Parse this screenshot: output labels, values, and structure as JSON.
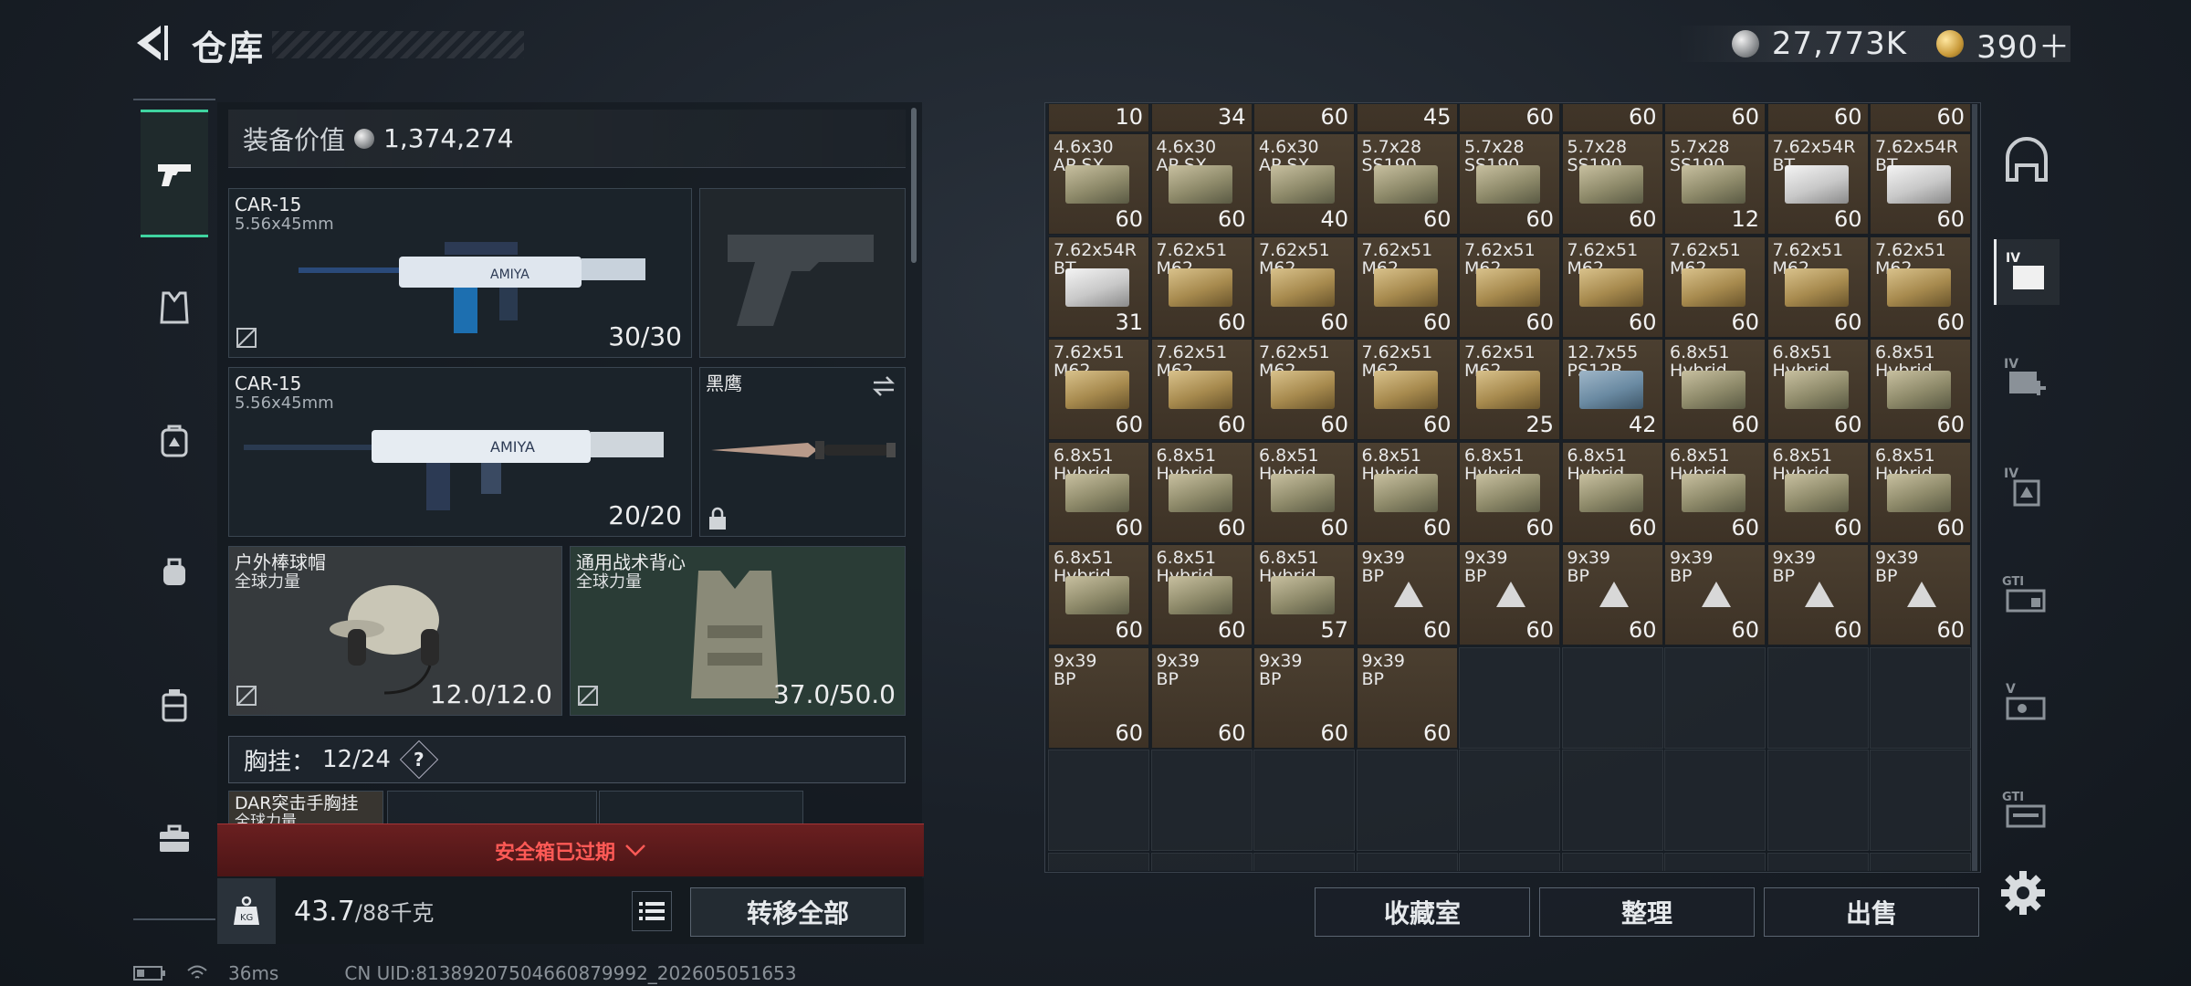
{
  "header": {
    "title": "仓库"
  },
  "currency": {
    "silver": "27,773K",
    "gold": "390＋"
  },
  "equipment": {
    "value_label": "装备价值",
    "value": "1,374,274",
    "primary_weapon": {
      "name": "CAR-15",
      "caliber": "5.56x45mm",
      "ammo": "30/30"
    },
    "secondary_weapon": {
      "name": "CAR-15",
      "caliber": "5.56x45mm",
      "ammo": "20/20"
    },
    "melee": {
      "name": "黑鹰"
    },
    "helmet": {
      "name": "户外棒球帽",
      "sub": "全球力量",
      "durability": "12.0/12.0"
    },
    "armor": {
      "name": "通用战术背心",
      "sub": "全球力量",
      "durability": "37.0/50.0"
    },
    "chest_rig": {
      "label": "胸挂：",
      "value": "12/24",
      "help": "?"
    },
    "rig_item": {
      "name": "DAR突击手胸挂",
      "sub": "全球力量"
    },
    "safebox_status": "安全箱已过期",
    "weight": {
      "value": "43.7",
      "capacity": "/88千克"
    },
    "transfer_all": "转移全部"
  },
  "status_bar": {
    "ping": "36ms",
    "uid": "CN UID:81389207504660879992_202605051653"
  },
  "inventory": {
    "top_row_qty": [
      "10",
      "34",
      "60",
      "45",
      "60",
      "60",
      "60",
      "60",
      "60"
    ],
    "rows": [
      [
        {
          "cal": "4.6x30\nAP SX",
          "qty": "60",
          "box": "olive"
        },
        {
          "cal": "4.6x30\nAP SX",
          "qty": "60",
          "box": "olive"
        },
        {
          "cal": "4.6x30\nAP SX",
          "qty": "40",
          "box": "olive"
        },
        {
          "cal": "5.7x28\nSS190",
          "qty": "60",
          "box": "olive"
        },
        {
          "cal": "5.7x28\nSS190",
          "qty": "60",
          "box": "olive"
        },
        {
          "cal": "5.7x28\nSS190",
          "qty": "60",
          "box": "olive"
        },
        {
          "cal": "5.7x28\nSS190",
          "qty": "12",
          "box": "olive"
        },
        {
          "cal": "7.62x54R\nBT",
          "qty": "60",
          "box": "white"
        },
        {
          "cal": "7.62x54R\nBT",
          "qty": "60",
          "box": "white"
        }
      ],
      [
        {
          "cal": "7.62x54R\nBT",
          "qty": "31",
          "box": "white"
        },
        {
          "cal": "7.62x51\nM62",
          "qty": "60",
          "box": "tan"
        },
        {
          "cal": "7.62x51\nM62",
          "qty": "60",
          "box": "tan"
        },
        {
          "cal": "7.62x51\nM62",
          "qty": "60",
          "box": "tan"
        },
        {
          "cal": "7.62x51\nM62",
          "qty": "60",
          "box": "tan"
        },
        {
          "cal": "7.62x51\nM62",
          "qty": "60",
          "box": "tan"
        },
        {
          "cal": "7.62x51\nM62",
          "qty": "60",
          "box": "tan"
        },
        {
          "cal": "7.62x51\nM62",
          "qty": "60",
          "box": "tan"
        },
        {
          "cal": "7.62x51\nM62",
          "qty": "60",
          "box": "tan"
        }
      ],
      [
        {
          "cal": "7.62x51\nM62",
          "qty": "60",
          "box": "tan"
        },
        {
          "cal": "7.62x51\nM62",
          "qty": "60",
          "box": "tan"
        },
        {
          "cal": "7.62x51\nM62",
          "qty": "60",
          "box": "tan"
        },
        {
          "cal": "7.62x51\nM62",
          "qty": "60",
          "box": "tan"
        },
        {
          "cal": "7.62x51\nM62",
          "qty": "25",
          "box": "tan"
        },
        {
          "cal": "12.7x55\nPS12B",
          "qty": "42",
          "box": "blue"
        },
        {
          "cal": "6.8x51\nHybrid",
          "qty": "60",
          "box": "olive"
        },
        {
          "cal": "6.8x51\nHybrid",
          "qty": "60",
          "box": "olive"
        },
        {
          "cal": "6.8x51\nHybrid",
          "qty": "60",
          "box": "olive"
        }
      ],
      [
        {
          "cal": "6.8x51\nHybrid",
          "qty": "60",
          "box": "olive"
        },
        {
          "cal": "6.8x51\nHybrid",
          "qty": "60",
          "box": "olive"
        },
        {
          "cal": "6.8x51\nHybrid",
          "qty": "60",
          "box": "olive"
        },
        {
          "cal": "6.8x51\nHybrid",
          "qty": "60",
          "box": "olive"
        },
        {
          "cal": "6.8x51\nHybrid",
          "qty": "60",
          "box": "olive"
        },
        {
          "cal": "6.8x51\nHybrid",
          "qty": "60",
          "box": "olive"
        },
        {
          "cal": "6.8x51\nHybrid",
          "qty": "60",
          "box": "olive"
        },
        {
          "cal": "6.8x51\nHybrid",
          "qty": "60",
          "box": "olive"
        },
        {
          "cal": "6.8x51\nHybrid",
          "qty": "60",
          "box": "olive"
        }
      ],
      [
        {
          "cal": "6.8x51\nHybrid",
          "qty": "60",
          "box": "olive"
        },
        {
          "cal": "6.8x51\nHybrid",
          "qty": "60",
          "box": "olive"
        },
        {
          "cal": "6.8x51\nHybrid",
          "qty": "57",
          "box": "olive"
        },
        {
          "cal": "9x39\nBP",
          "qty": "60",
          "box": "tri"
        },
        {
          "cal": "9x39\nBP",
          "qty": "60",
          "box": "tri"
        },
        {
          "cal": "9x39\nBP",
          "qty": "60",
          "box": "tri"
        },
        {
          "cal": "9x39\nBP",
          "qty": "60",
          "box": "tri"
        },
        {
          "cal": "9x39\nBP",
          "qty": "60",
          "box": "tri"
        },
        {
          "cal": "9x39\nBP",
          "qty": "60",
          "box": "tri"
        }
      ],
      [
        {
          "cal": "9x39\nBP",
          "qty": "60",
          "box": "none"
        },
        {
          "cal": "9x39\nBP",
          "qty": "60",
          "box": "none"
        },
        {
          "cal": "9x39\nBP",
          "qty": "60",
          "box": "none"
        },
        {
          "cal": "9x39\nBP",
          "qty": "60",
          "box": "none"
        }
      ]
    ]
  },
  "grid_buttons": {
    "collection": "收藏室",
    "sort": "整理",
    "sell": "出售"
  },
  "right_nav_labels": [
    "IV",
    "IV",
    "IV",
    "GTI",
    "V",
    "GTI"
  ]
}
